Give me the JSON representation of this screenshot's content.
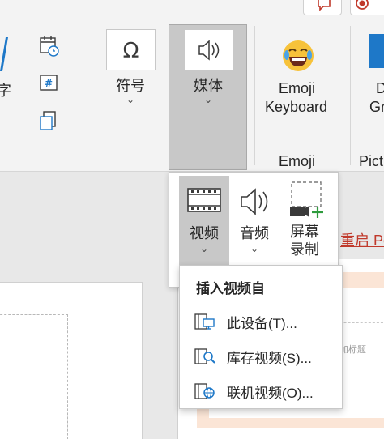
{
  "ribbon": {
    "partial_left_label": "字",
    "symbols_label": "符号",
    "media_label": "媒体",
    "emoji_keyboard_line1": "Emoji",
    "emoji_keyboard_line2": "Keyboard",
    "group_emoji_label": "Emoji",
    "group_pict_label": "Pict",
    "partial_right_line1": "D",
    "partial_right_line2": "Gr",
    "chevron": "⌄"
  },
  "media_dropdown": {
    "video": {
      "label": "视频"
    },
    "audio": {
      "label": "音频"
    },
    "screen_recording": {
      "line1": "屏幕",
      "line2": "录制"
    }
  },
  "video_submenu": {
    "title": "插入视频自",
    "items": [
      {
        "label": "此设备(T)...",
        "icon": "this-device-icon"
      },
      {
        "label": "库存视频(S)...",
        "icon": "stock-video-icon"
      },
      {
        "label": "联机视频(O)...",
        "icon": "online-video-icon"
      }
    ]
  },
  "document": {
    "restart_text": "重启 Po",
    "placeholder_text": "加标题"
  },
  "colors": {
    "ribbon_bg": "#f3f3f3",
    "selected_bg": "#c8c8c8",
    "accent_blue": "#1e78c8",
    "restart_red": "#c0392b",
    "slide_peach": "#fbe5d6"
  }
}
